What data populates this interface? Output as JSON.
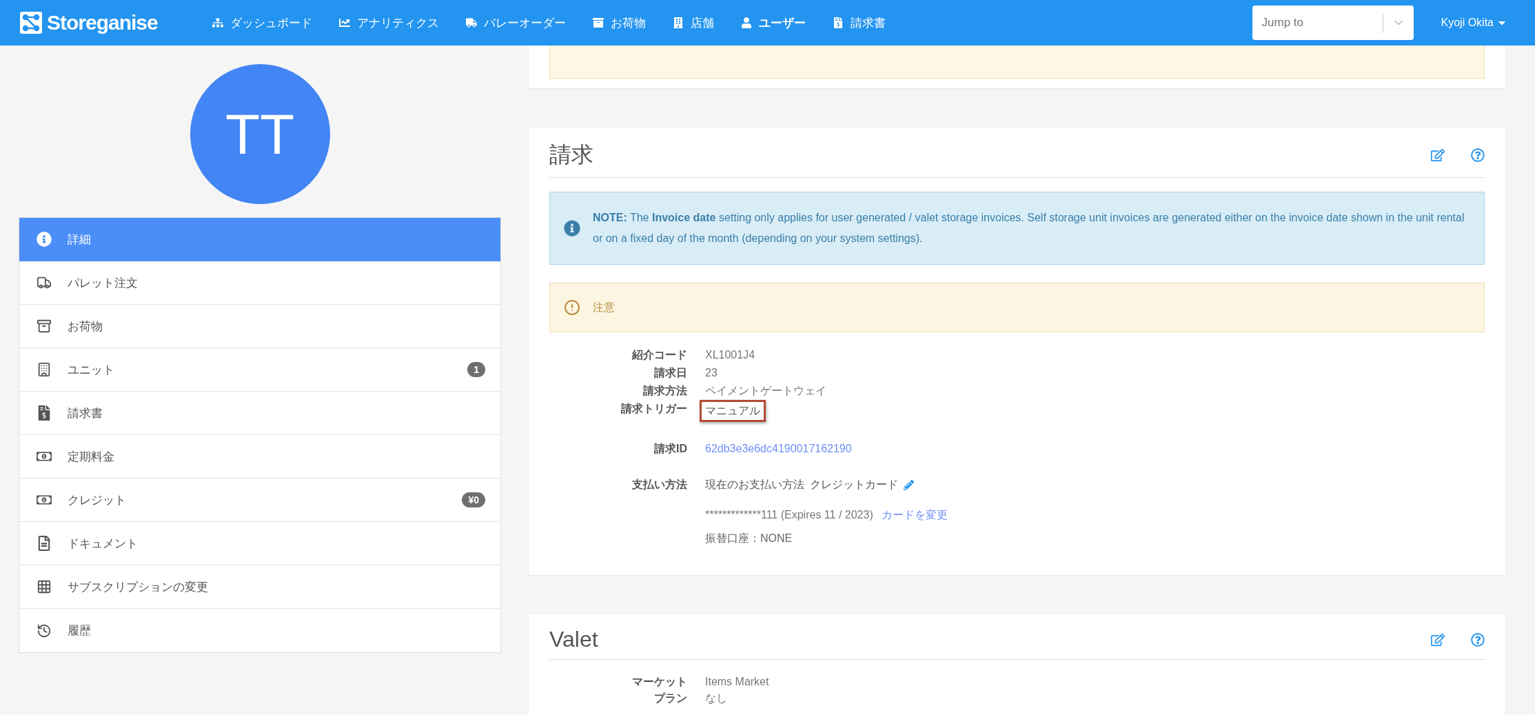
{
  "navbar": {
    "brand": "Storeganise",
    "items": [
      {
        "label": "ダッシュボード",
        "kind": "sitemap",
        "selected": false
      },
      {
        "label": "アナリティクス",
        "kind": "chart",
        "selected": false
      },
      {
        "label": "バレーオーダー",
        "kind": "truck",
        "selected": false
      },
      {
        "label": "お荷物",
        "kind": "archive",
        "selected": false
      },
      {
        "label": "店舗",
        "kind": "building",
        "selected": false
      },
      {
        "label": "ユーザー",
        "kind": "user",
        "selected": true
      },
      {
        "label": "請求書",
        "kind": "invoice",
        "selected": false
      }
    ],
    "jump_to": {
      "placeholder": "Jump to"
    },
    "user": "Kyoji Okita"
  },
  "avatar": {
    "initials": "TT"
  },
  "sidebar": {
    "items": [
      {
        "label": "詳細",
        "kind": "info",
        "selected": true
      },
      {
        "label": "パレット注文",
        "kind": "truck",
        "selected": false
      },
      {
        "label": "お荷物",
        "kind": "archive",
        "selected": false
      },
      {
        "label": "ユニット",
        "kind": "building",
        "selected": false,
        "badge": "1"
      },
      {
        "label": "請求書",
        "kind": "invoice",
        "selected": false
      },
      {
        "label": "定期料金",
        "kind": "money",
        "selected": false
      },
      {
        "label": "クレジット",
        "kind": "money",
        "selected": false,
        "badge": "¥0"
      },
      {
        "label": "ドキュメント",
        "kind": "document",
        "selected": false
      },
      {
        "label": "サブスクリプションの変更",
        "kind": "table",
        "selected": false
      },
      {
        "label": "履歴",
        "kind": "history",
        "selected": false
      }
    ]
  },
  "billing": {
    "title": "請求",
    "note": "**NOTE:** The **Invoice date** setting only applies for user generated / valet storage invoices. Self storage unit invoices are generated either on the invoice date shown in the unit rental or on a fixed day of the month (depending on your system settings).",
    "warning": "注意",
    "fields": [
      {
        "label": "紹介コード",
        "value": "XL1001J4",
        "kind": "text",
        "highlighted": false
      },
      {
        "label": "請求日",
        "value": "23",
        "kind": "text",
        "highlighted": false
      },
      {
        "label": "請求方法",
        "value": "ペイメントゲートウェイ",
        "kind": "text",
        "highlighted": false
      },
      {
        "label": "請求トリガー",
        "value": "マニュアル",
        "kind": "text",
        "highlighted": true
      },
      {
        "label": "請求ID",
        "value": "62db3e3e6dc4190017162190",
        "kind": "link",
        "highlighted": false
      }
    ],
    "payment": {
      "label": "支払い方法",
      "current": "現在のお支払い方法",
      "method": "クレジットカード",
      "card": "*************111 (Expires 11 / 2023)",
      "change_link": "カードを変更",
      "bank": "振替口座：NONE"
    }
  },
  "valet": {
    "title": "Valet",
    "fields": [
      {
        "label": "マーケット",
        "value": "Items Market"
      },
      {
        "label": "プラン",
        "value": "なし"
      }
    ]
  }
}
